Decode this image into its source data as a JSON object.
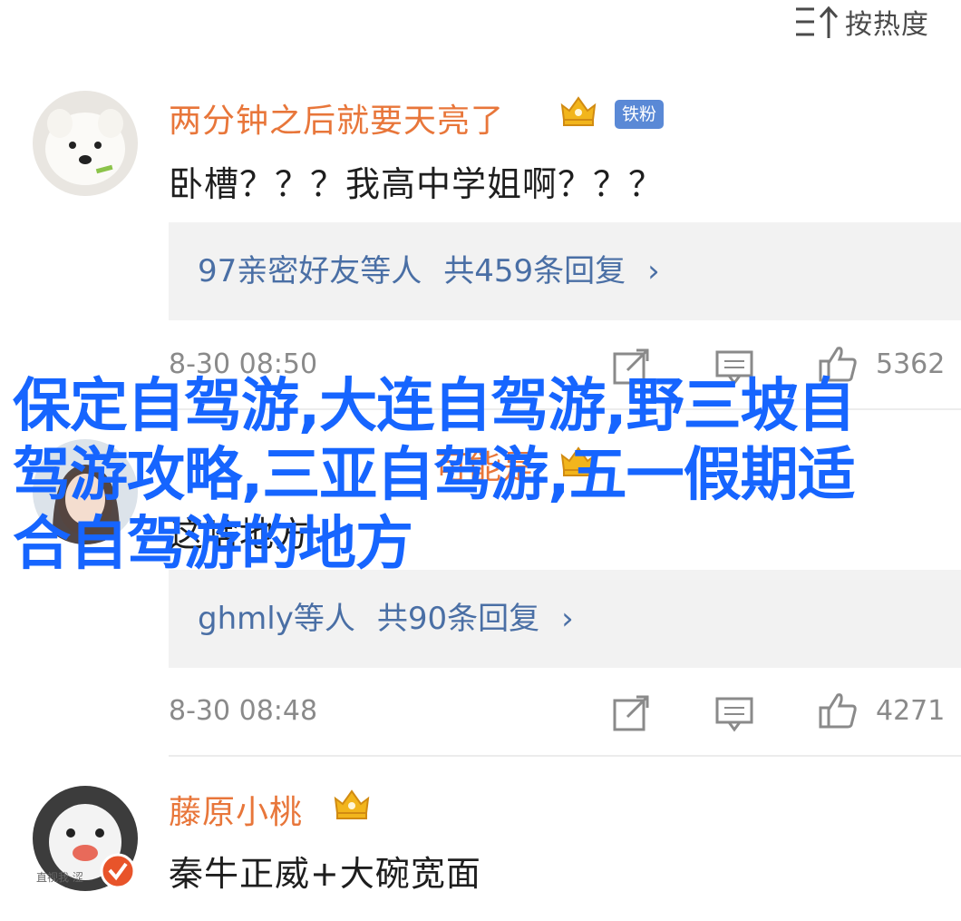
{
  "sort": {
    "label": "按热度",
    "icon": "sort-icon"
  },
  "comments": [
    {
      "username": "两分钟之后就要天亮了",
      "badge": "铁粉",
      "text": "卧槽？？？我高中学姐啊？？？",
      "replies": {
        "names": "97亲密好友等人",
        "count": "共459条回复",
        "arrow": "›"
      },
      "time": "8-30 08:50",
      "likes": "5362"
    },
    {
      "username": "可能是",
      "text": "这啥地方",
      "replies": {
        "names": "ghmly等人",
        "count": "共90条回复",
        "arrow": "›"
      },
      "time": "8-30 08:48",
      "likes": "4271"
    },
    {
      "username": "藤原小桃",
      "avatar_caption": "直视我·涩",
      "text": "秦牛正威+大碗宽面"
    }
  ],
  "overlay_title": "保定自驾游,大连自驾游,野三坡自驾游攻略,三亚自驾游,五一假期适合自驾游的地方",
  "colors": {
    "username": "#e8763a",
    "reply_link": "#4a6fa5",
    "badge": "#5a89d6",
    "overlay": "#1665ff",
    "crown": "#f2b51c",
    "verified": "#e8542a"
  }
}
